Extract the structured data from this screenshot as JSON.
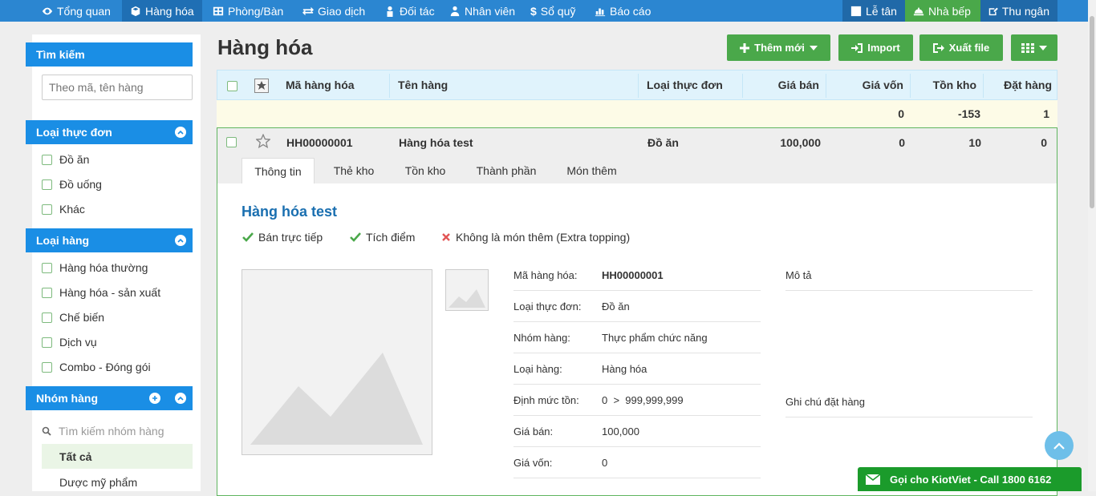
{
  "nav": {
    "items": [
      "Tổng quan",
      "Hàng hóa",
      "Phòng/Bàn",
      "Giao dịch",
      "Đối tác",
      "Nhân viên",
      "Sổ quỹ",
      "Báo cáo"
    ],
    "right": [
      "Lễ tân",
      "Nhà bếp",
      "Thu ngân"
    ]
  },
  "sidebar": {
    "search_title": "Tìm kiếm",
    "search_placeholder": "Theo mã, tên hàng",
    "menu_type_title": "Loại thực đơn",
    "menu_types": [
      "Đồ ăn",
      "Đồ uống",
      "Khác"
    ],
    "item_type_title": "Loại hàng",
    "item_types": [
      "Hàng hóa thường",
      "Hàng hóa - sản xuất",
      "Chế biến",
      "Dịch vụ",
      "Combo - Đóng gói"
    ],
    "group_title": "Nhóm hàng",
    "group_search_placeholder": "Tìm kiếm nhóm hàng",
    "groups": [
      "Tất cả",
      "Dược mỹ phẩm"
    ]
  },
  "main": {
    "title": "Hàng hóa",
    "buttons": {
      "add": "Thêm mới",
      "import": "Import",
      "export": "Xuất file"
    },
    "columns": [
      "Mã hàng hóa",
      "Tên hàng",
      "Loại thực đơn",
      "Giá bán",
      "Giá vốn",
      "Tồn kho",
      "Đặt hàng"
    ],
    "summary": {
      "cost": "0",
      "stock": "-153",
      "order": "1"
    },
    "row": {
      "code": "HH00000001",
      "name": "Hàng hóa test",
      "menu_type": "Đồ ăn",
      "price": "100,000",
      "cost": "0",
      "stock": "10",
      "order": "0"
    },
    "tabs": [
      "Thông tin",
      "Thẻ kho",
      "Tồn kho",
      "Thành phần",
      "Món thêm"
    ],
    "detail": {
      "title": "Hàng hóa test",
      "flags": [
        {
          "label": "Bán trực tiếp",
          "state": "yes"
        },
        {
          "label": "Tích điểm",
          "state": "yes"
        },
        {
          "label": "Không là món thêm (Extra topping)",
          "state": "no"
        }
      ],
      "fields": [
        {
          "label": "Mã hàng hóa:",
          "value": "HH00000001"
        },
        {
          "label": "Loại thực đơn:",
          "value": "Đồ ăn"
        },
        {
          "label": "Nhóm hàng:",
          "value": "Thực phẩm chức năng"
        },
        {
          "label": "Loại hàng:",
          "value": "Hàng hóa"
        },
        {
          "label": "Định mức tồn:",
          "value": "0  >  999,999,999"
        },
        {
          "label": "Giá bán:",
          "value": "100,000"
        },
        {
          "label": "Giá vốn:",
          "value": "0"
        }
      ],
      "desc_label": "Mô tả",
      "order_note_label": "Ghi chú đặt hàng"
    }
  },
  "call_bar": "Gọi cho KiotViet - Call 1800 6162",
  "colors": {
    "nav": "#2b86d1",
    "green": "#4aa84a",
    "sidebar_head": "#1a8ee5",
    "link": "#1a6fb0"
  }
}
